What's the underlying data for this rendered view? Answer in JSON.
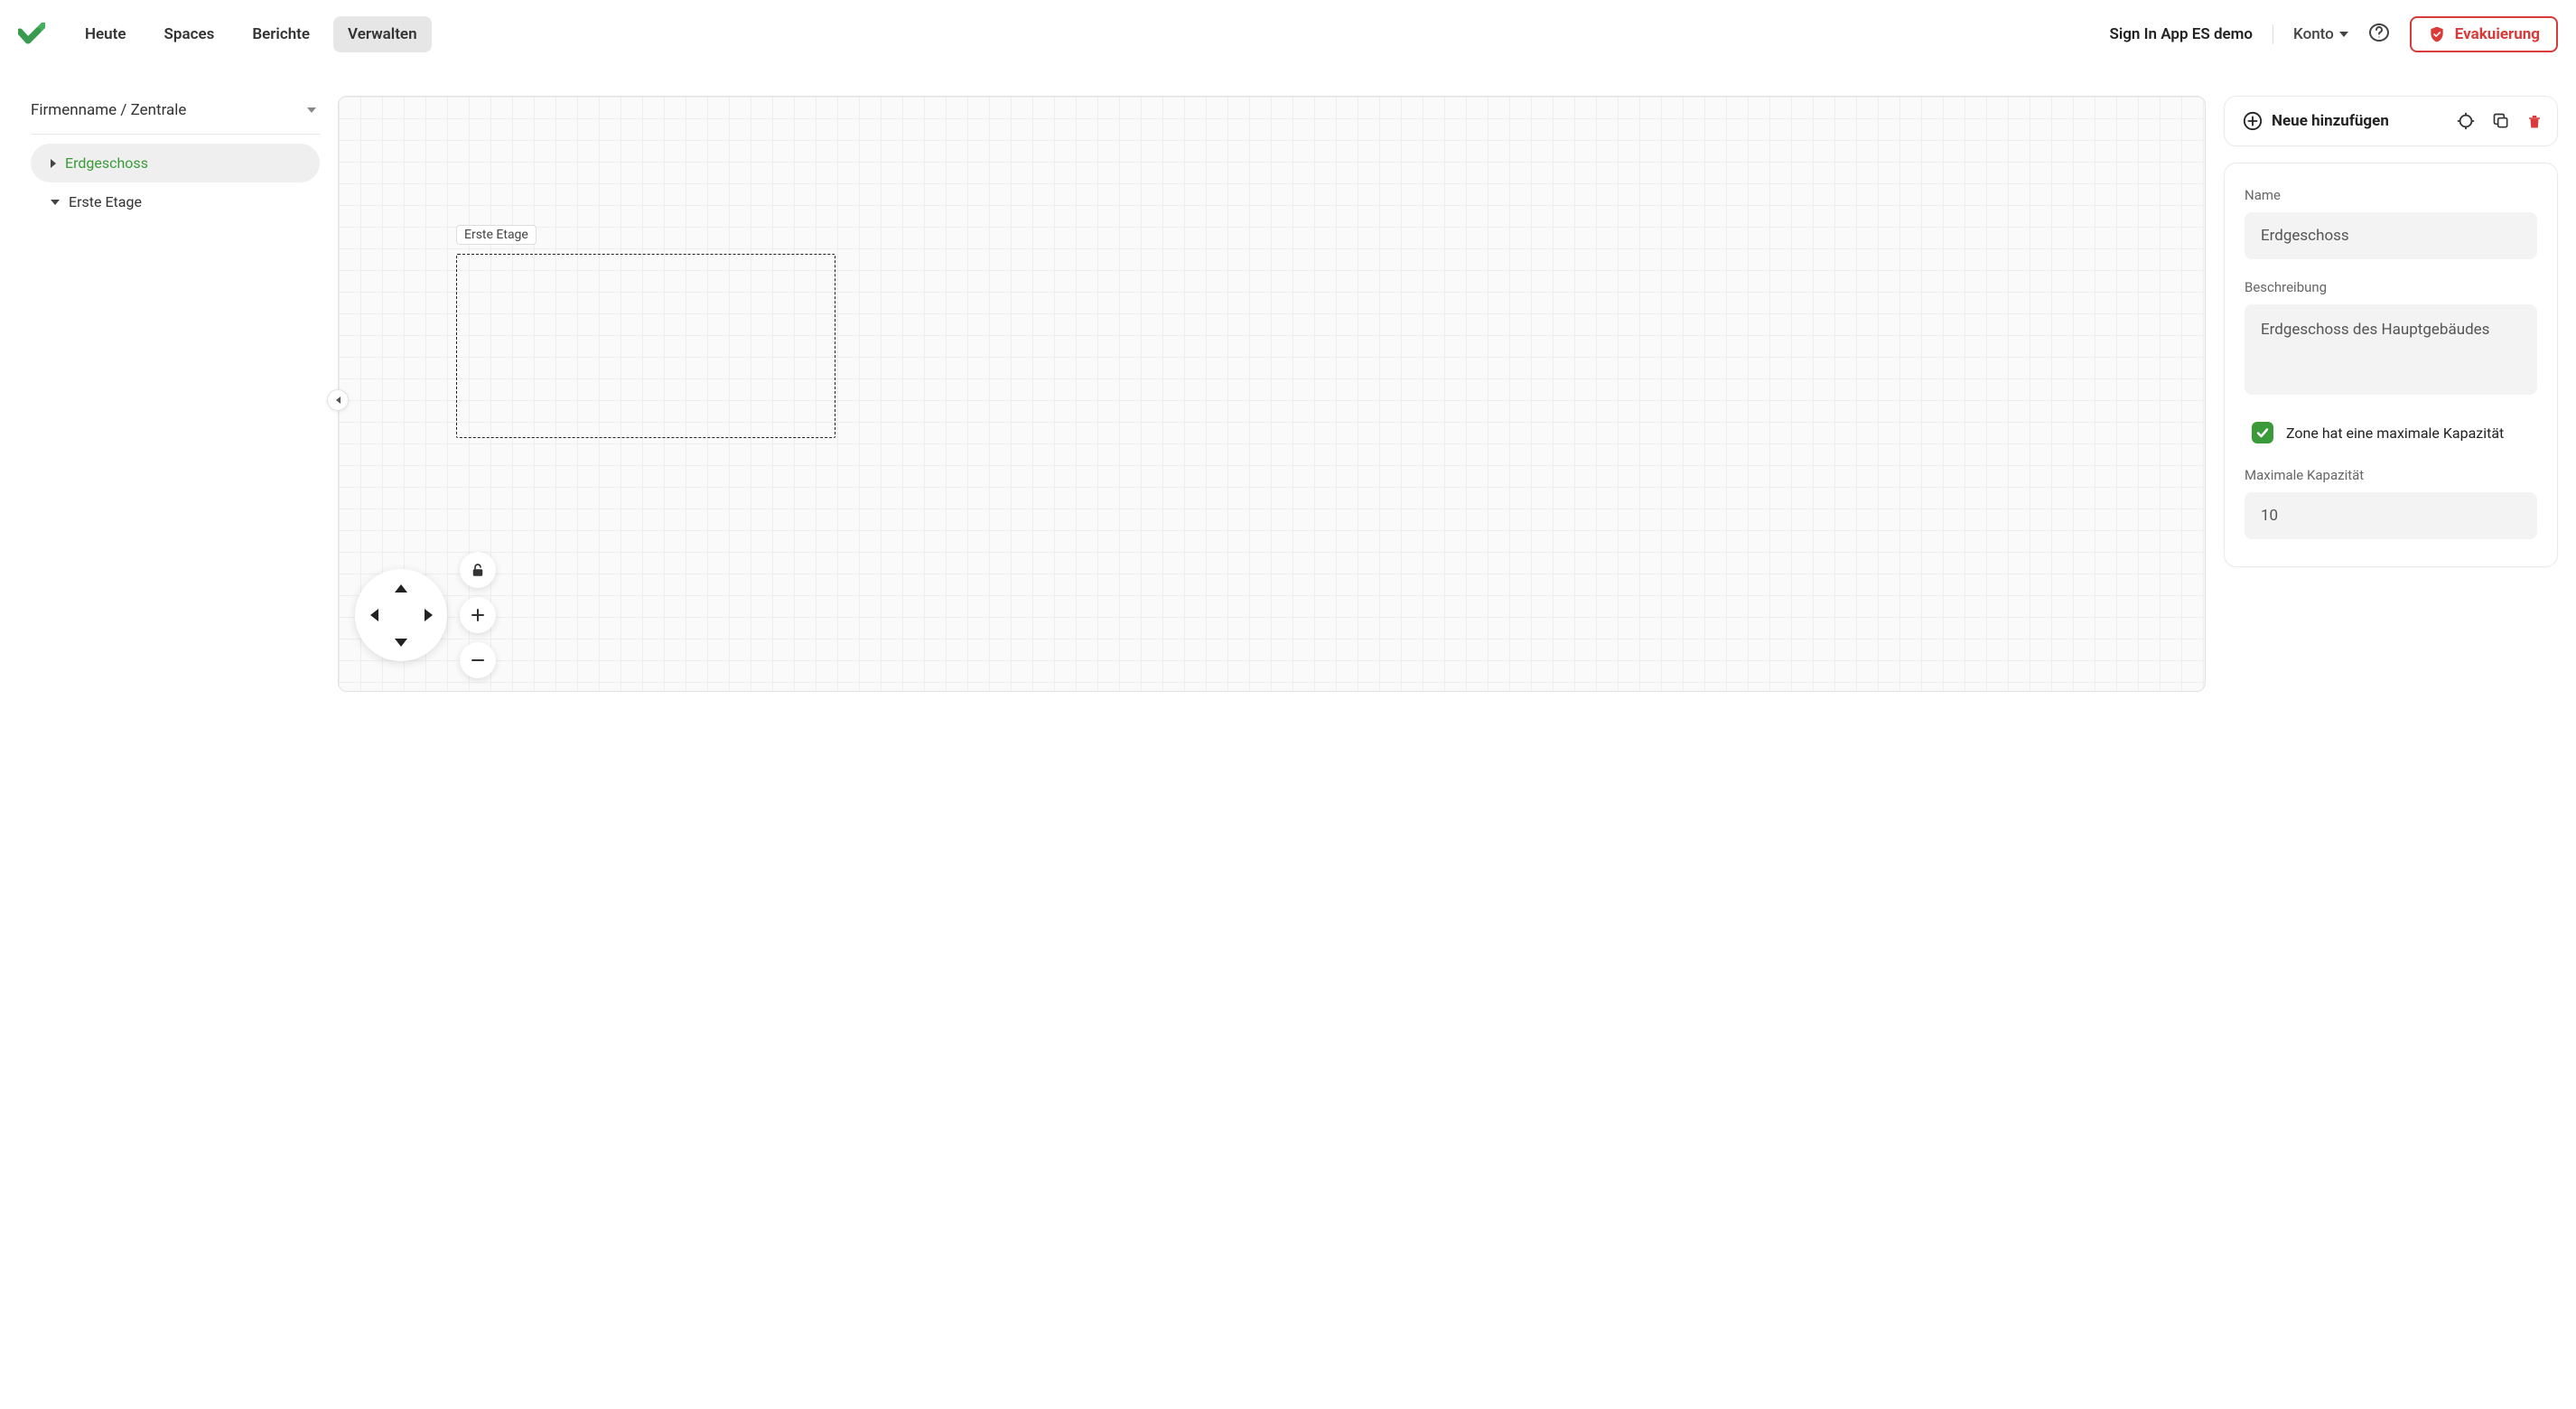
{
  "header": {
    "nav": {
      "heute": "Heute",
      "spaces": "Spaces",
      "berichte": "Berichte",
      "verwalten": "Verwalten"
    },
    "app_title": "Sign In App ES demo",
    "account_label": "Konto",
    "evacuation_label": "Evakuierung"
  },
  "sidebar": {
    "breadcrumb": "Firmenname / Zentrale",
    "items": [
      {
        "label": "Erdgeschoss",
        "selected": true,
        "expanded": false
      },
      {
        "label": "Erste Etage",
        "selected": false,
        "expanded": true
      }
    ]
  },
  "canvas": {
    "zone_label": "Erste Etage"
  },
  "toolbar": {
    "add_label": "Neue hinzufügen"
  },
  "props": {
    "name_label": "Name",
    "name_value": "Erdgeschoss",
    "description_label": "Beschreibung",
    "description_value": "Erdgeschoss des Hauptgebäudes",
    "capacity_check_label": "Zone hat eine maximale Kapazität",
    "capacity_checked": true,
    "max_capacity_label": "Maximale Kapazität",
    "max_capacity_value": "10"
  }
}
